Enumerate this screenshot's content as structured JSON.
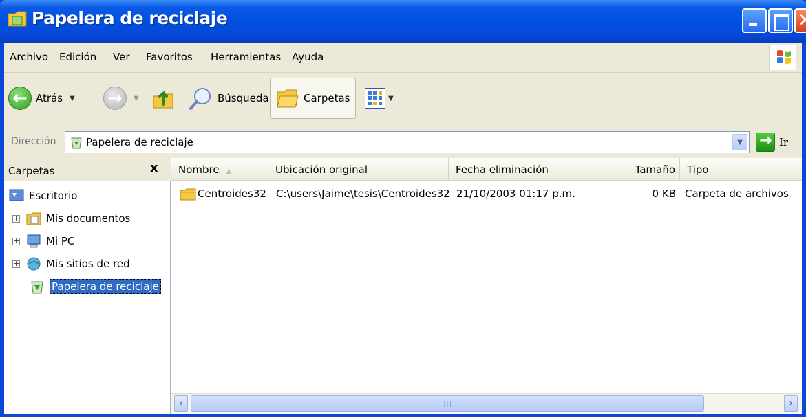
{
  "window": {
    "title": "Papelera de reciclaje",
    "title_color": "#0050e0"
  },
  "menubar": {
    "items": [
      "Archivo",
      "Edición",
      "Ver",
      "Favoritos",
      "Herramientas",
      "Ayuda"
    ]
  },
  "toolbar": {
    "back_label": "Atrás",
    "search_label": "Búsqueda",
    "folders_label": "Carpetas",
    "icons": [
      "back-arrow-icon",
      "forward-arrow-icon",
      "folder-up-icon",
      "search-magnifier-icon",
      "folders-icon",
      "views-icon"
    ]
  },
  "address": {
    "label": "Dirección",
    "value": "Papelera de reciclaje",
    "go_label": "Ir"
  },
  "folder_pane": {
    "title": "Carpetas",
    "close": "x",
    "tree": [
      {
        "label": "Escritorio",
        "icon": "desktop-icon",
        "expander": false,
        "selected": false
      },
      {
        "label": "Mis documentos",
        "icon": "documents-folder-icon",
        "expander": true,
        "selected": false
      },
      {
        "label": "Mi PC",
        "icon": "computer-icon",
        "expander": true,
        "selected": false
      },
      {
        "label": "Mis sitios de red",
        "icon": "network-icon",
        "expander": true,
        "selected": false
      },
      {
        "label": "Papelera de reciclaje",
        "icon": "recycle-bin-icon",
        "expander": false,
        "selected": true
      }
    ]
  },
  "list": {
    "columns": [
      "Nombre",
      "Ubicación original",
      "Fecha eliminación",
      "Tamaño",
      "Tipo"
    ],
    "rows": [
      {
        "name": "Centroides32",
        "location": "C:\\users\\Jaime\\tesis\\Centroides32",
        "deleted": "21/10/2003 01:17 p.m.",
        "size": "0 KB",
        "type": "Carpeta de archivos"
      }
    ]
  },
  "colors": {
    "selection": "#316ac5",
    "chrome": "#ece9d8",
    "frame": "#0a46d8"
  }
}
